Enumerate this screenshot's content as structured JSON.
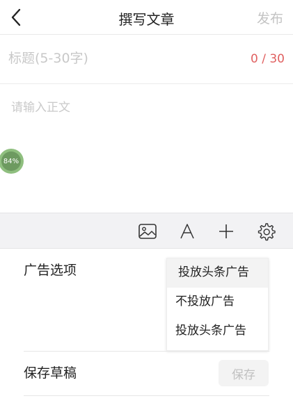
{
  "header": {
    "title": "撰写文章",
    "publish_label": "发布"
  },
  "title_field": {
    "placeholder": "标题(5-30字)",
    "value": "",
    "counter": "0 / 30"
  },
  "body_field": {
    "placeholder": "请输入正文",
    "value": ""
  },
  "progress": {
    "label": "84%",
    "value": 84
  },
  "toolbar": {
    "icons": [
      "image-icon",
      "font-icon",
      "plus-icon",
      "gear-icon"
    ]
  },
  "settings": {
    "ad_label": "广告选项",
    "ad_selected": "投放头条广告",
    "ad_options": [
      "不投放广告",
      "投放头条广告"
    ],
    "draft_label": "保存草稿",
    "save_label": "保存"
  },
  "colors": {
    "counter": "#e06060",
    "publish_disabled": "#c4c4c4",
    "toolbar_bg": "#f2f2f4"
  }
}
